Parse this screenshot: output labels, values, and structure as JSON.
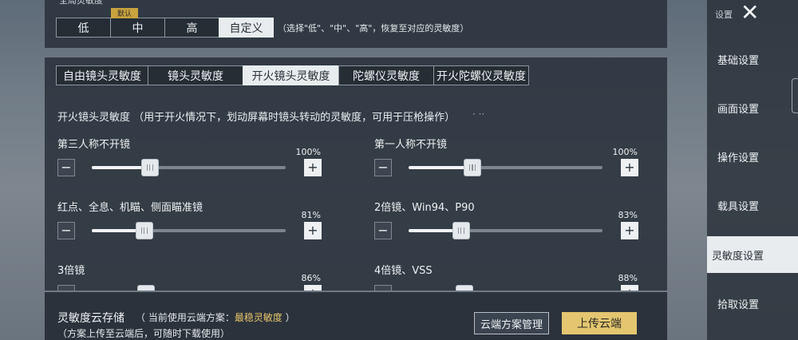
{
  "preset": {
    "cut_title": "全局灵敏度",
    "badge": "默认",
    "options": [
      "低",
      "中",
      "高",
      "自定义"
    ],
    "hint": "（选择\"低\"、\"中\"、\"高\"，恢复至对应的灵敏度）"
  },
  "tabs": [
    "自由镜头灵敏度",
    "镜头灵敏度",
    "开火镜头灵敏度",
    "陀螺仪灵敏度",
    "开火陀螺仪灵敏度"
  ],
  "section": {
    "title": "开火镜头灵敏度 （用于开火情况下，划动屏幕时镜头转动的灵敏度，可用于压枪操作）",
    "dots": "· ··"
  },
  "sliders": [
    {
      "label": "第三人称不开镜",
      "percent": "100%",
      "value": 0.3
    },
    {
      "label": "第一人称不开镜",
      "percent": "100%",
      "value": 0.33
    },
    {
      "label": "红点、全息、机瞄、侧面瞄准镜",
      "percent": "81%",
      "value": 0.27
    },
    {
      "label": "2倍镜、Win94、P90",
      "percent": "83%",
      "value": 0.27
    },
    {
      "label": "3倍镜",
      "percent": "86%",
      "value": 0.28
    },
    {
      "label": "4倍镜、VSS",
      "percent": "88%",
      "value": 0.29
    }
  ],
  "cloud": {
    "title": "灵敏度云存储",
    "current_prefix": "（ 当前使用云端方案：",
    "current_plan": "最稳灵敏度",
    "current_suffix": " ）",
    "note": "（方案上传至云端后，可随时下载使用）",
    "manage_label": "云端方案管理",
    "upload_label": "上传云端"
  },
  "sidebar": {
    "top_label": "设置",
    "items": [
      "基础设置",
      "画面设置",
      "操作设置",
      "载具设置",
      "灵敏度设置",
      "拾取设置"
    ]
  },
  "icons": {
    "minus": "−",
    "plus": "+",
    "close": "✕"
  },
  "colors": {
    "accent": "#e4c671",
    "active_tab": "#e9ecee"
  }
}
